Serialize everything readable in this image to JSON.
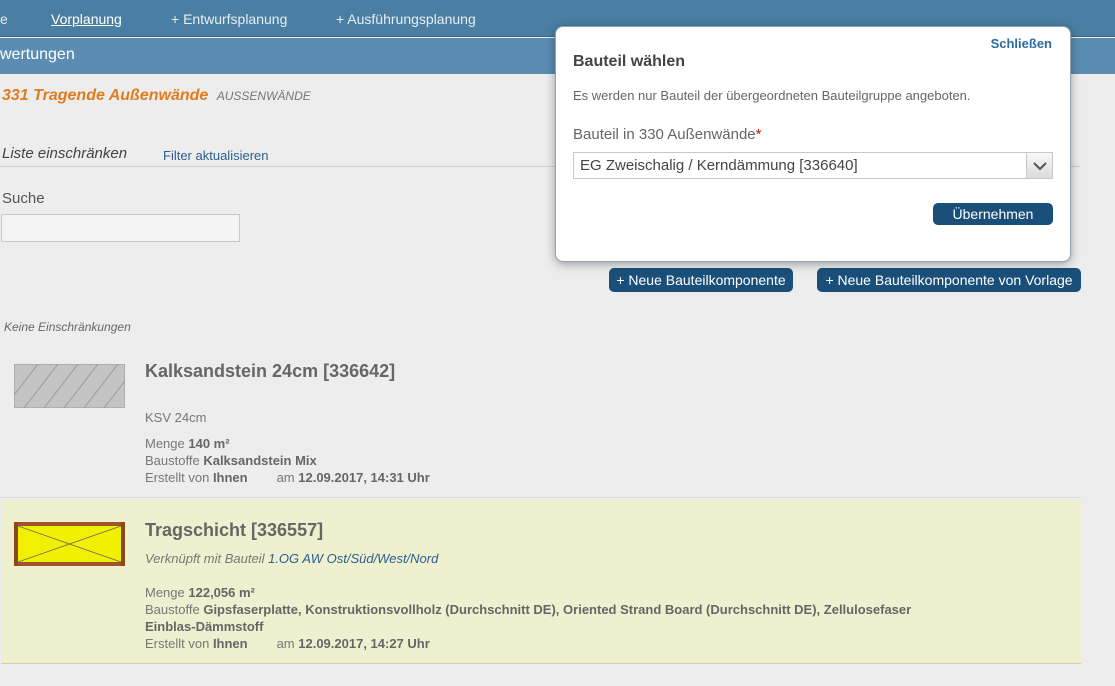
{
  "nav": {
    "cut_item": "e",
    "items": [
      "Vorplanung",
      "+ Entwurfsplanung",
      "+ Ausführungsplanung"
    ]
  },
  "subbar": {
    "title": "wertungen"
  },
  "heading": {
    "title": "331 Tragende Außenwände",
    "tag": "AUSSENWÄNDE"
  },
  "filter": {
    "title": "Liste einschränken",
    "update_link": "Filter aktualisieren",
    "search_label": "Suche",
    "search_value": ""
  },
  "actions": {
    "new_component": "+ Neue Bauteilkomponente",
    "new_from_template": "+ Neue Bauteilkomponente von Vorlage"
  },
  "no_restrictions": "Keine Einschränkungen",
  "components": [
    {
      "name": "Kalksandstein 24cm [336642]",
      "subtitle": "KSV 24cm",
      "menge_label": "Menge",
      "menge_value": "140 m²",
      "baustoffe_label": "Baustoffe",
      "baustoffe_value": "Kalksandstein Mix",
      "created_label": "Erstellt von",
      "created_by": "Ihnen",
      "date_prefix": "am",
      "date": "12.09.2017, 14:31 Uhr"
    },
    {
      "name": "Tragschicht [336557]",
      "link_prefix": "Verknüpft mit Bauteil",
      "link_text": "1.OG AW Ost/Süd/West/Nord",
      "menge_label": "Menge",
      "menge_value": "122,056 m²",
      "baustoffe_label": "Baustoffe",
      "baustoffe_value_1": "Gipsfaserplatte, Konstruktionsvollholz (Durchschnitt DE), Oriented Strand Board (Durchschnitt DE), Zellulosefaser",
      "baustoffe_value_2": "Einblas-Dämmstoff",
      "created_label": "Erstellt von",
      "created_by": "Ihnen",
      "date_prefix": "am",
      "date": "12.09.2017, 14:27 Uhr"
    }
  ],
  "popup": {
    "close": "Schließen",
    "title": "Bauteil wählen",
    "description": "Es werden nur Bauteil der übergeordneten Bauteilgruppe angeboten.",
    "field_label": "Bauteil in 330 Außenwände",
    "required_mark": "*",
    "selected_value": "EG Zweischalig / Kerndämmung [336640]",
    "submit": "Übernehmen"
  },
  "colors": {
    "nav_bg": "#4a7fa3",
    "subbar_bg": "#5a8db1",
    "heading_accent": "#e07b1e",
    "button_bg": "#1a4f7a",
    "highlight_row": "#eff0cf",
    "link": "#2e5e8c"
  }
}
